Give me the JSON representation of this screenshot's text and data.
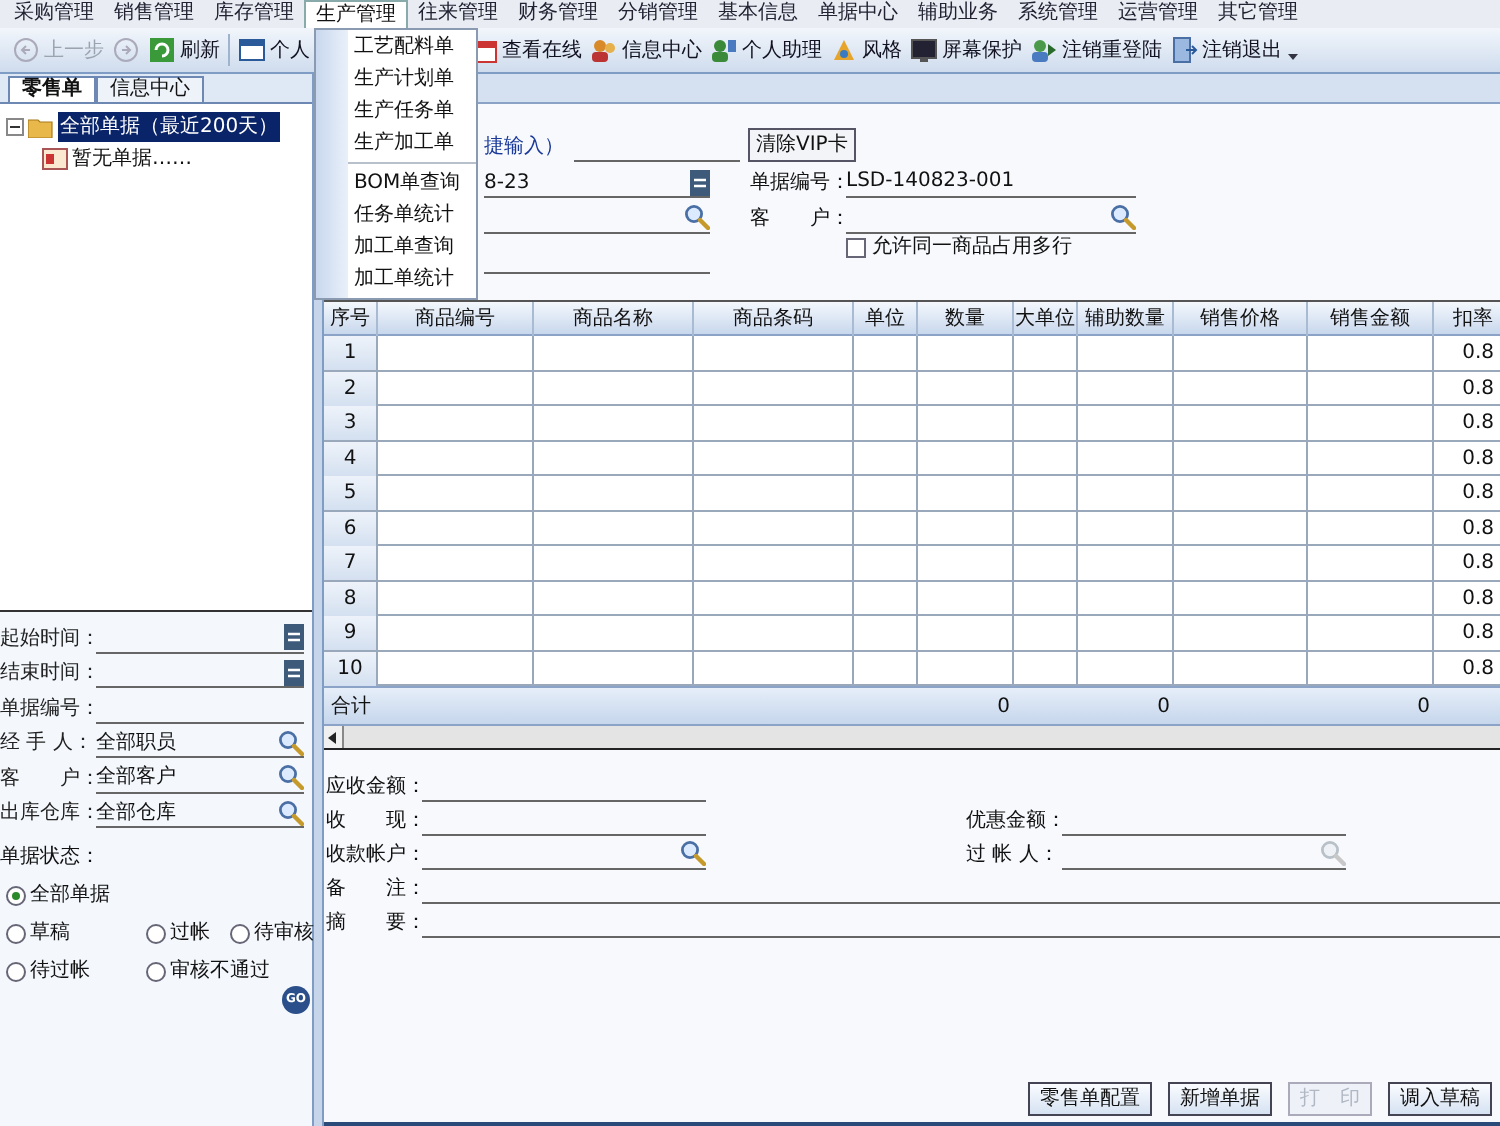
{
  "menubar": [
    {
      "label": "采购管理",
      "selected": false
    },
    {
      "label": "销售管理",
      "selected": false
    },
    {
      "label": "库存管理",
      "selected": false
    },
    {
      "label": "生产管理",
      "selected": true
    },
    {
      "label": "往来管理",
      "selected": false
    },
    {
      "label": "财务管理",
      "selected": false
    },
    {
      "label": "分销管理",
      "selected": false
    },
    {
      "label": "基本信息",
      "selected": false
    },
    {
      "label": "单据中心",
      "selected": false
    },
    {
      "label": "辅助业务",
      "selected": false
    },
    {
      "label": "系统管理",
      "selected": false
    },
    {
      "label": "运营管理",
      "selected": false
    },
    {
      "label": "其它管理",
      "selected": false
    }
  ],
  "dropdown_menu": {
    "groups": [
      [
        "工艺配料单",
        "生产计划单",
        "生产任务单",
        "生产加工单"
      ],
      [
        "BOM单查询",
        "任务单统计",
        "加工单查询",
        "加工单统计"
      ]
    ]
  },
  "toolbar_left": [
    {
      "label": "上一步",
      "disabled": true
    },
    {
      "disabled": true
    },
    {
      "label": "刷新",
      "disabled": false
    },
    {
      "label": "个人",
      "disabled": false
    }
  ],
  "toolbar_right": [
    {
      "label": "查看在线"
    },
    {
      "label": "信息中心"
    },
    {
      "label": "个人助理"
    },
    {
      "label": "风格"
    },
    {
      "label": "屏幕保护"
    },
    {
      "label": "注销重登陆"
    },
    {
      "label": "注销退出"
    }
  ],
  "left_panel": {
    "tabs": [
      {
        "label": "零售单",
        "selected": true
      },
      {
        "label": "信息中心",
        "selected": false
      }
    ],
    "tree": {
      "label": "全部单据（最近200天）",
      "selected": true,
      "expanded": true,
      "children": [
        {
          "label": "暂无单据……"
        }
      ]
    },
    "filters": [
      {
        "label": "起始时间：",
        "kind": "date"
      },
      {
        "label": "结束时间：",
        "kind": "date"
      },
      {
        "label": "单据编号：",
        "kind": "text"
      },
      {
        "label": "经 手 人：",
        "kind": "lookup",
        "value": "全部职员"
      },
      {
        "label": "客　　户：",
        "kind": "lookup",
        "value": "全部客户"
      },
      {
        "label": "出库仓库：",
        "kind": "lookup",
        "value": "全部仓库"
      }
    ],
    "status_label": "单据状态：",
    "status_options": [
      [
        {
          "label": "全部单据",
          "selected": true
        }
      ],
      [
        {
          "label": "草稿",
          "selected": false
        },
        {
          "label": "过帐",
          "selected": false
        },
        {
          "label": "待审核",
          "selected": false
        }
      ],
      [
        {
          "label": "待过帐",
          "selected": false
        },
        {
          "label": "审核不通过",
          "selected": false
        }
      ]
    ],
    "go_button": "GO"
  },
  "form": {
    "quick_input_hint": "捷输入）",
    "clear_vip_button": "清除VIP卡",
    "date_value": "8-23",
    "doc_no_label": "单据编号：",
    "doc_no": "LSD-140823-001",
    "customer_label": "客　　户：",
    "allow_multi": {
      "label": "允许同一商品占用多行",
      "checked": false
    }
  },
  "table": {
    "columns": [
      "序号",
      "商品编号",
      "商品名称",
      "商品条码",
      "单位",
      "数量",
      "大单位",
      "辅助数量",
      "销售价格",
      "销售金额",
      "扣率"
    ],
    "rows": [
      {
        "no": "1",
        "discount": "0.8"
      },
      {
        "no": "2",
        "discount": "0.8"
      },
      {
        "no": "3",
        "discount": "0.8"
      },
      {
        "no": "4",
        "discount": "0.8"
      },
      {
        "no": "5",
        "discount": "0.8"
      },
      {
        "no": "6",
        "discount": "0.8"
      },
      {
        "no": "7",
        "discount": "0.8"
      },
      {
        "no": "8",
        "discount": "0.8"
      },
      {
        "no": "9",
        "discount": "0.8"
      },
      {
        "no": "10",
        "discount": "0.8"
      }
    ],
    "totals": {
      "label": "合计",
      "quantity": "0",
      "aux_quantity": "0",
      "amount": "0"
    }
  },
  "bottom": {
    "left_fields": [
      {
        "label": "应收金额：",
        "kind": "text"
      },
      {
        "label": "收　　现：",
        "kind": "text"
      },
      {
        "label": "收款帐户：",
        "kind": "lookup",
        "disabled": false
      }
    ],
    "right_fields": [
      {
        "label": "优惠金额：",
        "kind": "text"
      },
      {
        "label": "过 帐 人：",
        "kind": "lookup",
        "disabled": true
      }
    ],
    "note_fields": [
      {
        "label": "备　　注："
      },
      {
        "label": "摘　　要："
      }
    ],
    "buttons": [
      {
        "label": "零售单配置",
        "disabled": false
      },
      {
        "label": "新增单据",
        "disabled": false
      },
      {
        "label": "打　印",
        "disabled": true
      },
      {
        "label": "调入草稿",
        "disabled": false
      }
    ]
  }
}
